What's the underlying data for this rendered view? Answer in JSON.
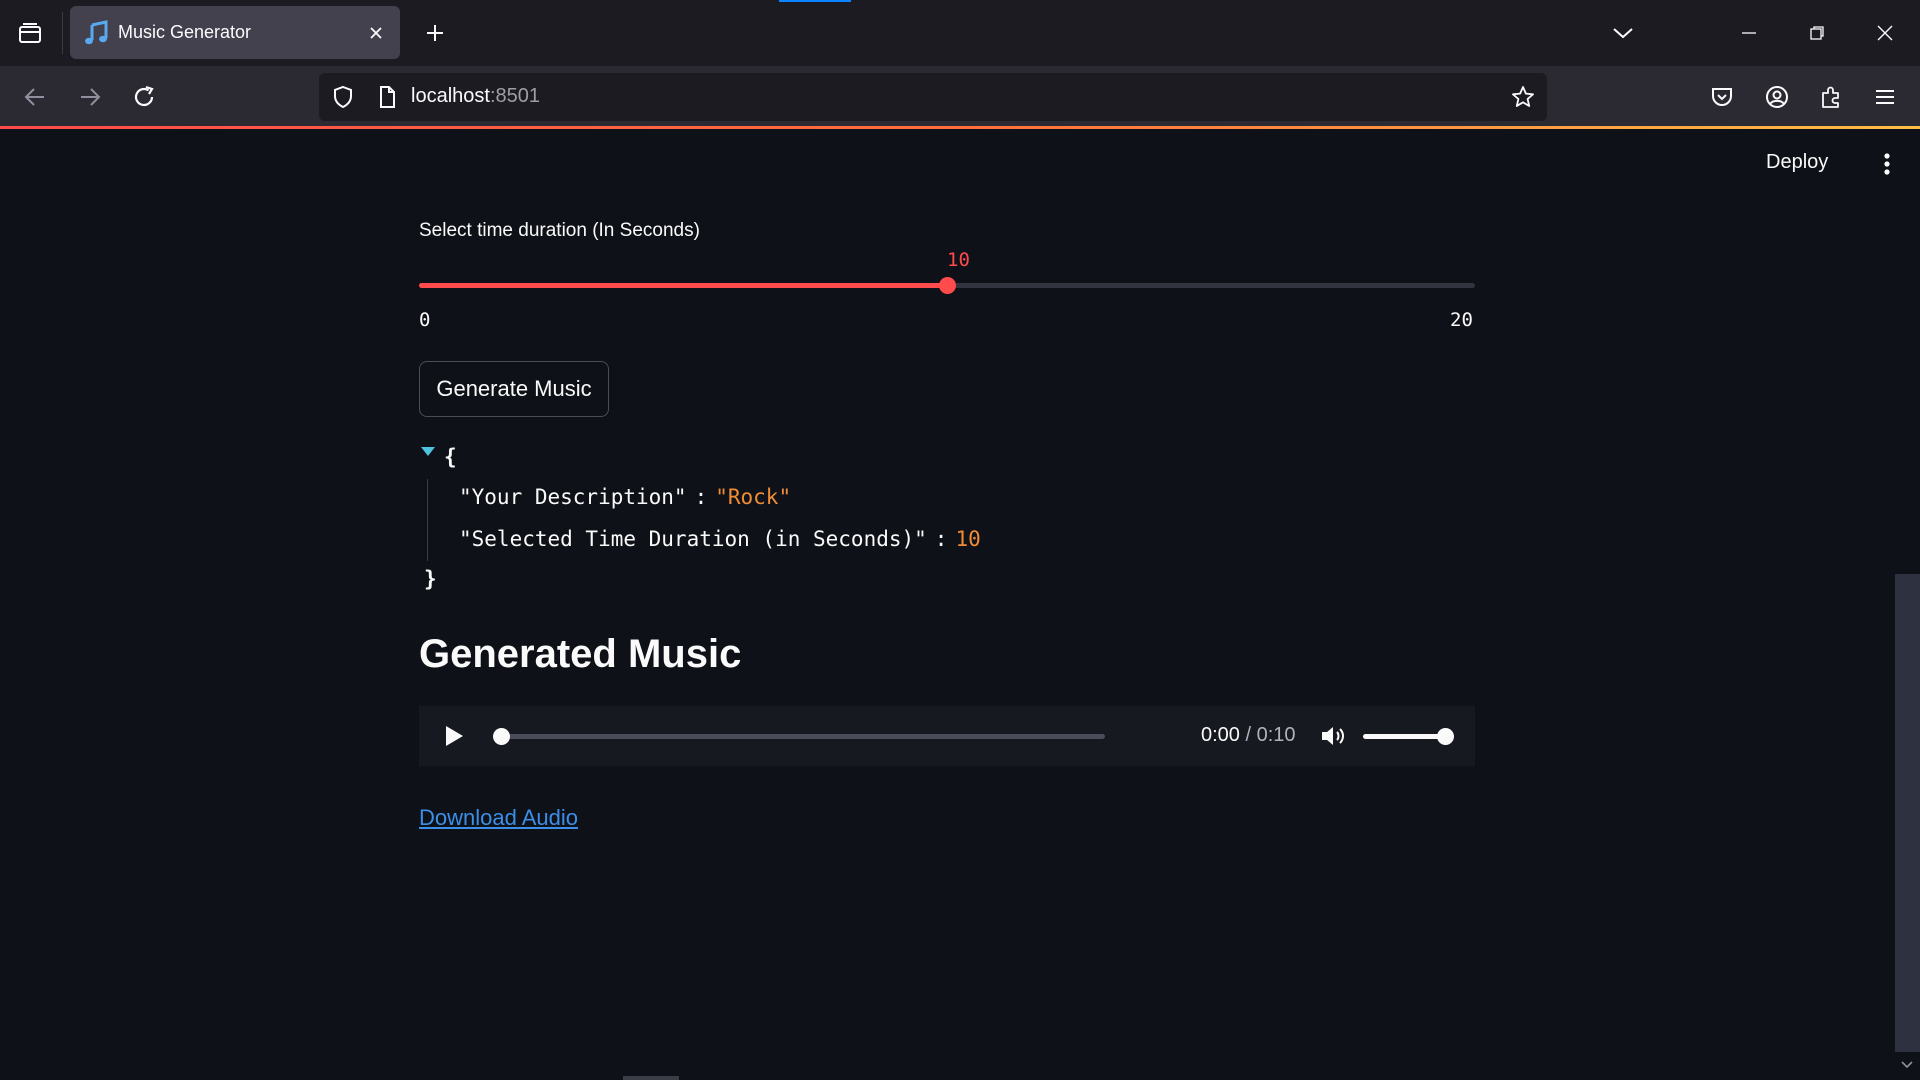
{
  "browser": {
    "tab_title": "Music Generator",
    "url_host": "localhost",
    "url_port": ":8501"
  },
  "header": {
    "deploy_label": "Deploy"
  },
  "slider": {
    "label": "Select time duration (In Seconds)",
    "value": "10",
    "min": "0",
    "max": "20"
  },
  "generate_button_label": "Generate Music",
  "json_view": {
    "open_brace": "{",
    "close_brace": "}",
    "colon": ":",
    "entries": [
      {
        "key": "\"Your Description\"",
        "value": "\"Rock\""
      },
      {
        "key": "\"Selected Time Duration (in Seconds)\"",
        "value": "10"
      }
    ]
  },
  "section_title": "Generated Music",
  "audio": {
    "current_time": "0:00",
    "separator": " / ",
    "duration": "0:10",
    "progress_fraction": 0,
    "volume_fraction": 1
  },
  "download_link": "Download Audio",
  "colors": {
    "accent": "#ff4b4b",
    "background": "#0e1117",
    "json_value": "#f08c36",
    "link": "#3b8fe8"
  },
  "icons": {
    "tab_favicon": "music-note-icon",
    "security": "shield-icon",
    "page": "page-icon",
    "bookmark": "star-icon"
  }
}
